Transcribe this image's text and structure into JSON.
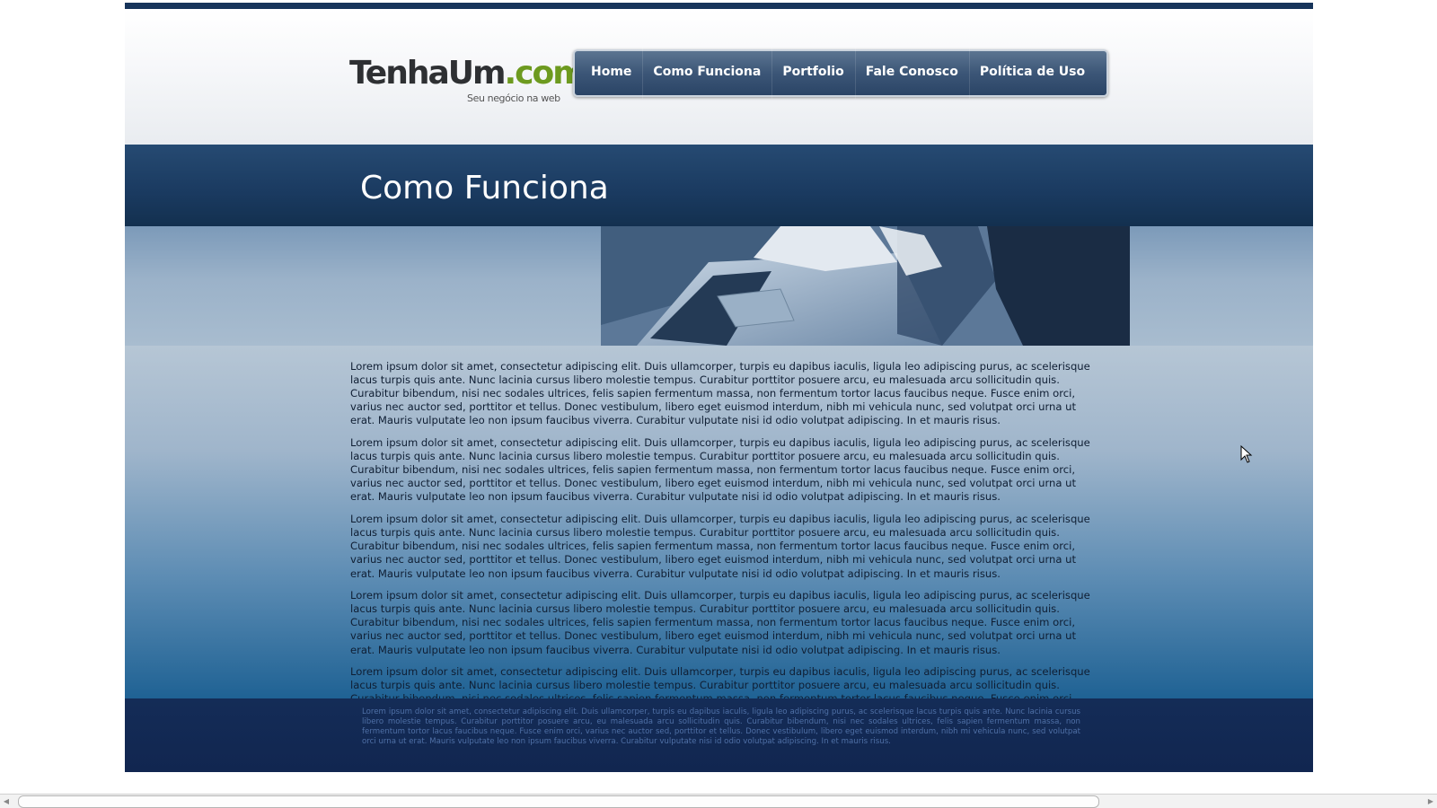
{
  "header": {
    "logo_main": "TenhaUm",
    "logo_suffix": ".com",
    "logo_tagline": "Seu negócio na web"
  },
  "nav": {
    "items": [
      {
        "label": "Home"
      },
      {
        "label": "Como Funciona"
      },
      {
        "label": "Portfolio"
      },
      {
        "label": "Fale Conosco"
      },
      {
        "label": "Política de Uso"
      }
    ]
  },
  "page": {
    "title": "Como Funciona"
  },
  "content": {
    "paragraphs": [
      "Lorem ipsum dolor sit amet, consectetur adipiscing elit. Duis ullamcorper, turpis eu dapibus iaculis, ligula leo adipiscing purus, ac scelerisque lacus turpis quis ante. Nunc lacinia cursus libero molestie tempus. Curabitur porttitor posuere arcu, eu malesuada arcu sollicitudin quis. Curabitur bibendum, nisi nec sodales ultrices, felis sapien fermentum massa, non fermentum tortor lacus faucibus neque. Fusce enim orci, varius nec auctor sed, porttitor et tellus. Donec vestibulum, libero eget euismod interdum, nibh mi vehicula nunc, sed volutpat orci urna ut erat. Mauris vulputate leo non ipsum faucibus viverra. Curabitur vulputate nisi id odio volutpat adipiscing. In et mauris risus.",
      "Lorem ipsum dolor sit amet, consectetur adipiscing elit. Duis ullamcorper, turpis eu dapibus iaculis, ligula leo adipiscing purus, ac scelerisque lacus turpis quis ante. Nunc lacinia cursus libero molestie tempus. Curabitur porttitor posuere arcu, eu malesuada arcu sollicitudin quis. Curabitur bibendum, nisi nec sodales ultrices, felis sapien fermentum massa, non fermentum tortor lacus faucibus neque. Fusce enim orci, varius nec auctor sed, porttitor et tellus. Donec vestibulum, libero eget euismod interdum, nibh mi vehicula nunc, sed volutpat orci urna ut erat. Mauris vulputate leo non ipsum faucibus viverra. Curabitur vulputate nisi id odio volutpat adipiscing. In et mauris risus.",
      "Lorem ipsum dolor sit amet, consectetur adipiscing elit. Duis ullamcorper, turpis eu dapibus iaculis, ligula leo adipiscing purus, ac scelerisque lacus turpis quis ante. Nunc lacinia cursus libero molestie tempus. Curabitur porttitor posuere arcu, eu malesuada arcu sollicitudin quis. Curabitur bibendum, nisi nec sodales ultrices, felis sapien fermentum massa, non fermentum tortor lacus faucibus neque. Fusce enim orci, varius nec auctor sed, porttitor et tellus. Donec vestibulum, libero eget euismod interdum, nibh mi vehicula nunc, sed volutpat orci urna ut erat. Mauris vulputate leo non ipsum faucibus viverra. Curabitur vulputate nisi id odio volutpat adipiscing. In et mauris risus.",
      "Lorem ipsum dolor sit amet, consectetur adipiscing elit. Duis ullamcorper, turpis eu dapibus iaculis, ligula leo adipiscing purus, ac scelerisque lacus turpis quis ante. Nunc lacinia cursus libero molestie tempus. Curabitur porttitor posuere arcu, eu malesuada arcu sollicitudin quis. Curabitur bibendum, nisi nec sodales ultrices, felis sapien fermentum massa, non fermentum tortor lacus faucibus neque. Fusce enim orci, varius nec auctor sed, porttitor et tellus. Donec vestibulum, libero eget euismod interdum, nibh mi vehicula nunc, sed volutpat orci urna ut erat. Mauris vulputate leo non ipsum faucibus viverra. Curabitur vulputate nisi id odio volutpat adipiscing. In et mauris risus.",
      "Lorem ipsum dolor sit amet, consectetur adipiscing elit. Duis ullamcorper, turpis eu dapibus iaculis, ligula leo adipiscing purus, ac scelerisque lacus turpis quis ante. Nunc lacinia cursus libero molestie tempus. Curabitur porttitor posuere arcu, eu malesuada arcu sollicitudin quis. Curabitur bibendum, nisi nec sodales ultrices, felis sapien fermentum massa, non fermentum tortor lacus faucibus neque. Fusce enim orci, varius nec auctor sed, porttitor et tellus. Donec vestibulum, libero eget euismod interdum, nibh mi vehicula nunc, sed volutpat orci urna ut erat."
    ]
  },
  "footer": {
    "text": "Lorem ipsum dolor sit amet, consectetur adipiscing elit. Duis ullamcorper, turpis eu dapibus iaculis, ligula leo adipiscing purus, ac scelerisque lacus turpis quis ante. Nunc lacinia cursus libero molestie tempus. Curabitur porttitor posuere arcu, eu malesuada arcu sollicitudin quis. Curabitur bibendum, nisi nec sodales ultrices, felis sapien fermentum massa, non fermentum tortor lacus faucibus neque. Fusce enim orci, varius nec auctor sed, porttitor et tellus. Donec vestibulum, libero eget euismod interdum, nibh mi vehicula nunc, sed volutpat orci urna ut erat. Mauris vulputate leo non ipsum faucibus viverra. Curabitur vulputate nisi id odio volutpat adipiscing. In et mauris risus."
  },
  "icons": {
    "scroll_up": "arrow-up-icon",
    "scroll_down": "arrow-down-icon",
    "scroll_left": "arrow-left-icon",
    "scroll_right": "arrow-right-icon",
    "cursor": "mouse-pointer-icon"
  },
  "colors": {
    "nav_bg": "#3c5677",
    "title_band": "#1a3a60",
    "footer_bg": "#122a53",
    "logo_accent": "#6d9a1f"
  }
}
